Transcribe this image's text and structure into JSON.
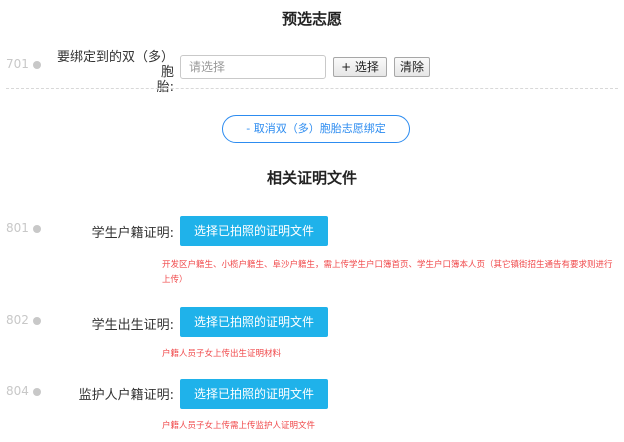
{
  "prefill_section": {
    "title": "预选志愿"
  },
  "twin_question": {
    "number": "701",
    "label_line1": "要绑定到的双（多）胞",
    "label_line2": "胎:",
    "input_placeholder": "请选择",
    "select_button": "+ 选择",
    "clear_button": "清除",
    "unbind_button": "- 取消双（多）胞胎志愿绑定"
  },
  "documents_section": {
    "title": "相关证明文件",
    "items": [
      {
        "number": "801",
        "label": "学生户籍证明:",
        "button": "选择已拍照的证明文件",
        "hint": "开发区户籍生、小榄户籍生、阜沙户籍生，需上传学生户口簿首页、学生户口簿本人页（其它镇街招生通告有要求则进行上传）"
      },
      {
        "number": "802",
        "label": "学生出生证明:",
        "button": "选择已拍照的证明文件",
        "hint": "户籍人员子女上传出生证明材料"
      },
      {
        "number": "804",
        "label": "监护人户籍证明:",
        "button": "选择已拍照的证明文件",
        "hint": "户籍人员子女上传需上传监护人证明文件"
      }
    ]
  }
}
